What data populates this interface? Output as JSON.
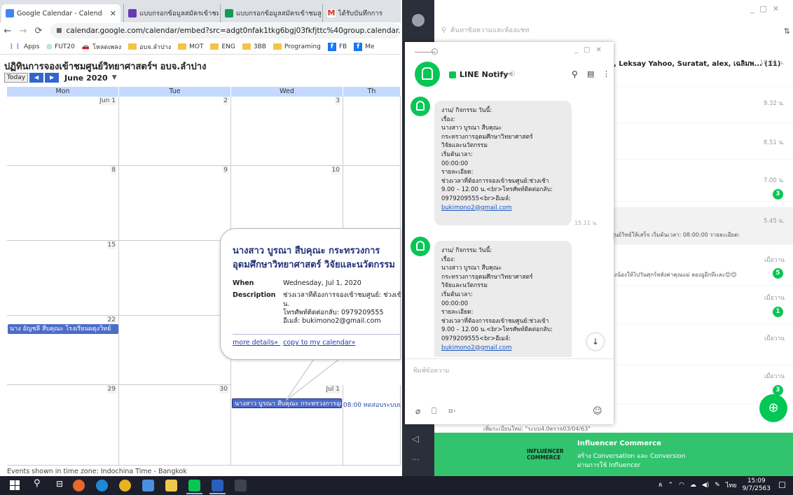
{
  "browser": {
    "tabs": [
      {
        "title": "Google Calendar - Calend",
        "favicon_color": "#4285f4"
      },
      {
        "title": "แบบกรอกข้อมูลสมัครเข้าชมสู",
        "favicon_color": "#673ab7"
      },
      {
        "title": "แบบกรอกข้อมูลสมัครเข้าชมสู",
        "favicon_color": "#0f9d58"
      },
      {
        "title": "ได้รับบันทึกการ",
        "favicon_color": "#d93025"
      }
    ],
    "url": "calendar.google.com/calendar/embed?src=adgt0nfak1tkg6bgj03fkfjttc%40group.calendar.goo",
    "bookmarks": [
      "Apps",
      "FUT20",
      "โหลดเพลง",
      "อบจ.ลำปาง",
      "MOT",
      "ENG",
      "3BB",
      "Programing",
      "FB",
      "Me"
    ]
  },
  "calendar": {
    "title": "ปฏิทินการจองเข้าชมศูนย์วิทยาศาสตร์ฯ อบจ.ลำปาง",
    "today_label": "Today",
    "month_label": "June 2020",
    "day_headers": [
      "Mon",
      "Tue",
      "Wed",
      "Th"
    ],
    "weeks": [
      [
        "Jun 1",
        "2",
        "3",
        ""
      ],
      [
        "8",
        "9",
        "10",
        ""
      ],
      [
        "15",
        "",
        "",
        ""
      ],
      [
        "22",
        "",
        "",
        ""
      ],
      [
        "29",
        "30",
        "Jul 1",
        ""
      ]
    ],
    "events": [
      {
        "text": "นาง อัญชลี สืบคุณะ โรงเรียนผดุงวิทย์"
      },
      {
        "text": "นางสาว บูรณา สืบคุณะ กระทรวงการอุดมศึกษาฯ"
      },
      {
        "text": "08:00 ทดสอบระบบบ"
      }
    ],
    "timezone_note": "Events shown in time zone: Indochina Time - Bangkok",
    "popup": {
      "title": "นางสาว บูรณา สืบคุณะ กระทรวงการอุดมศึกษาวิทยาศาสตร์ วิจัยและนวัตกรรม",
      "when_label": "When",
      "when_value": "Wednesday, Jul 1, 2020",
      "description_label": "Description",
      "description_lines": [
        "ช่วงเวลาที่ต้องการจองเข้าชมศูนย์: ช่วงเข้า",
        "น.",
        "โทรศัพท์ติดต่อกลับ: 0979209555",
        "อีเมล์: bukimono2@gmail.com"
      ],
      "more_details": "more details»",
      "copy_link": "copy to my calendar»"
    }
  },
  "line_main": {
    "search_placeholder": "ค้นหาข้อความและห้องแชท",
    "rows": [
      {
        "name": ", Leksay Yahoo, Suratat, alex, เฉลิมพ... (11)",
        "time": "10.36 น.",
        "preview": "",
        "badge": ""
      },
      {
        "name": "",
        "time": "9.32 น.",
        "preview": "",
        "badge": ""
      },
      {
        "name": "",
        "time": "8.51 น.",
        "preview": "",
        "badge": ""
      },
      {
        "name": "",
        "time": "7.00 น.",
        "preview": "",
        "badge": "3"
      },
      {
        "name": "",
        "time": "5.45 น.",
        "preview": "ศูนย์วิทย์ให้เสร็จ เริ่มต้นเวลา: 08:00:00 รายละเอียด:",
        "badge": ""
      },
      {
        "name": "",
        "time": "เมื่อวาน",
        "preview": "องน้องให้ไปวันศุกร์หลังค่าคุณแม่ ลองอูอีกทีเเละ😊😊",
        "badge": "5"
      },
      {
        "name": "",
        "time": "เมื่อวาน",
        "preview": "",
        "badge": "1"
      },
      {
        "name": "",
        "time": "เมื่อวาน",
        "preview": "",
        "badge": ""
      },
      {
        "name": "",
        "time": "เมื่อวาน",
        "preview": "",
        "badge": "3"
      }
    ],
    "footer_preview": "เพิ่มระเบียนใหม่: \"ระบบ4.0ตรวจ03/04/63\"",
    "banner": {
      "title": "Influencer Commerce",
      "line1": "สร้าง Conversation และ Conversion",
      "line2": "ผ่านการใช้ Influencer",
      "logo": "INFLUENCER COMMERCE"
    }
  },
  "line_notify": {
    "title": "LINE Notify",
    "messages": [
      {
        "lines": [
          "งาน/ กิจกรรม วันนี้:",
          "เรื่อง:",
          "นางสาว บูรณา สืบคุณะ",
          "กระทรวงการอุดมศึกษาวิทยาศาสตร์",
          "วิจัยและนวัตกรรม",
          "เริ่มต้นเวลา:",
          "00:00:00",
          "รายละเอียด:",
          "ช่วงเวลาที่ต้องการจองเข้าชมศูนย์:ช่วงเช้า",
          "9.00 – 12.00 น.<br>โทรศัพท์ติดต่อกลับ:",
          "0979209555<br>อีเมล์:"
        ],
        "email": "bukimono2@gmail.com",
        "time": "15.11 น."
      },
      {
        "lines": [
          "งาน/ กิจกรรม วันนี้:",
          "เรื่อง:",
          "นางสาว บูรณา สืบคุณะ",
          "กระทรวงการอุดมศึกษาวิทยาศาสตร์",
          "วิจัยและนวัตกรรม",
          "เริ่มต้นเวลา:",
          "00:00:00",
          "รายละเอียด:",
          "ช่วงเวลาที่ต้องการจองเข้าชมศูนย์:ช่วงเข้า",
          "9.00 – 12.00 น.<br>โทรศัพท์ติดต่อกลับ:",
          "0979209555<br>อีเมล์:"
        ],
        "email": "bukimono2@gmail.com"
      }
    ],
    "input_placeholder": "พิมพ์ข้อความ"
  },
  "taskbar": {
    "ime": "ไทย",
    "time": "15:09",
    "date": "9/7/2563"
  }
}
